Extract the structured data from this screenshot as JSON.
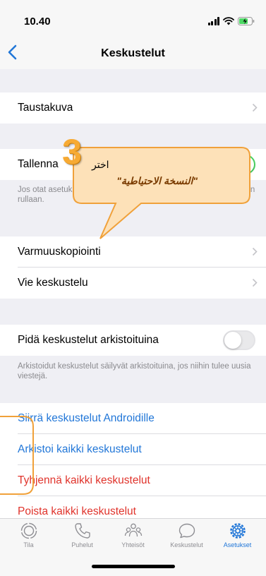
{
  "status_bar": {
    "time": "10.40"
  },
  "nav": {
    "title": "Keskustelut"
  },
  "rows": {
    "taustakuva": "Taustakuva",
    "tallenna": "Tallenna",
    "tallenna_footer": "Jos otat asetuksen käyttöön, kuvat ja videot tallennetaan kameran rullaan.",
    "varmuuskopiointi": "Varmuuskopiointi",
    "vie_keskustelu": "Vie keskustelu",
    "arkistoituina": "Pidä keskustelut arkistoituina",
    "arkistoituina_footer": "Arkistoidut keskustelut säilyvät arkistoituina, jos niihin tulee uusia viestejä.",
    "siirra": "Siirrä keskustelut Androidille",
    "arkistoi": "Arkistoi kaikki keskustelut",
    "tyhjenna": "Tyhjennä kaikki keskustelut",
    "poista": "Poista kaikki keskustelut"
  },
  "toggles": {
    "tallenna_on": true,
    "arkistoituina_on": false
  },
  "tabs": [
    {
      "label": "Tila",
      "icon": "status-icon"
    },
    {
      "label": "Puhelut",
      "icon": "phone-icon"
    },
    {
      "label": "Yhteisöt",
      "icon": "communities-icon"
    },
    {
      "label": "Keskustelut",
      "icon": "chats-icon"
    },
    {
      "label": "Asetukset",
      "icon": "settings-gear-icon",
      "active": true
    }
  ],
  "callout": {
    "number": "3",
    "line1": "اختر",
    "line2": "\"النسخة الاحتياطية\""
  },
  "colors": {
    "accent": "#2277d8",
    "destructive": "#e0332b",
    "callout_fill": "#fde1b8",
    "callout_stroke": "#f0a13a"
  }
}
